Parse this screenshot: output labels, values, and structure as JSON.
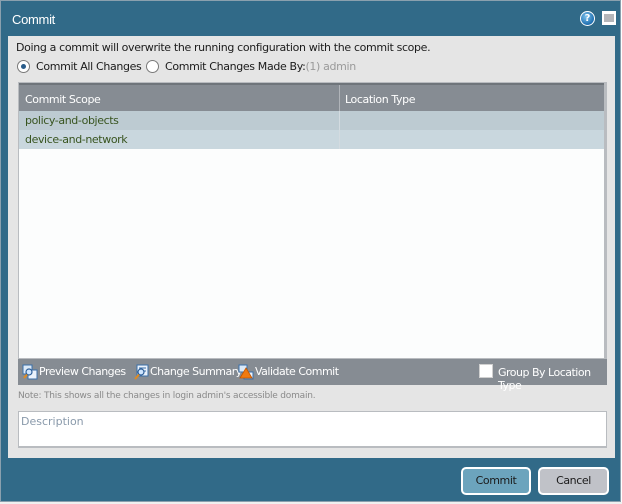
{
  "dialog": {
    "title": "Commit",
    "help_icon_glyph": "?",
    "intro_text": "Doing a commit will overwrite the running configuration with the commit scope.",
    "radio_options": [
      {
        "label": "Commit All Changes",
        "checked": true
      },
      {
        "label": "Commit Changes Made By:",
        "suffix": "(1) admin",
        "checked": false
      }
    ],
    "grid": {
      "columns": [
        "Commit Scope",
        "Location Type"
      ],
      "rows": [
        {
          "commit_scope": "policy-and-objects",
          "location_type": ""
        },
        {
          "commit_scope": "device-and-network",
          "location_type": ""
        }
      ]
    },
    "toolbar": {
      "preview_changes": "Preview Changes",
      "change_summary": "Change Summary",
      "validate_commit": "Validate Commit",
      "group_by_location_type": "Group By Location Type",
      "group_by_checked": false
    },
    "note": "Note: This shows all the changes in login admin's accessible domain.",
    "description_placeholder": "Description",
    "buttons": {
      "commit": "Commit",
      "cancel": "Cancel"
    }
  },
  "colors": {
    "frame": "#316a88",
    "panel": "#e5e5e5",
    "grid_header": "#868c93",
    "row_selected_1": "#bdcbd2",
    "row_selected_2": "#c9d7de",
    "commit_button": "#6ca4bd",
    "cancel_button": "#c0c2c8"
  }
}
